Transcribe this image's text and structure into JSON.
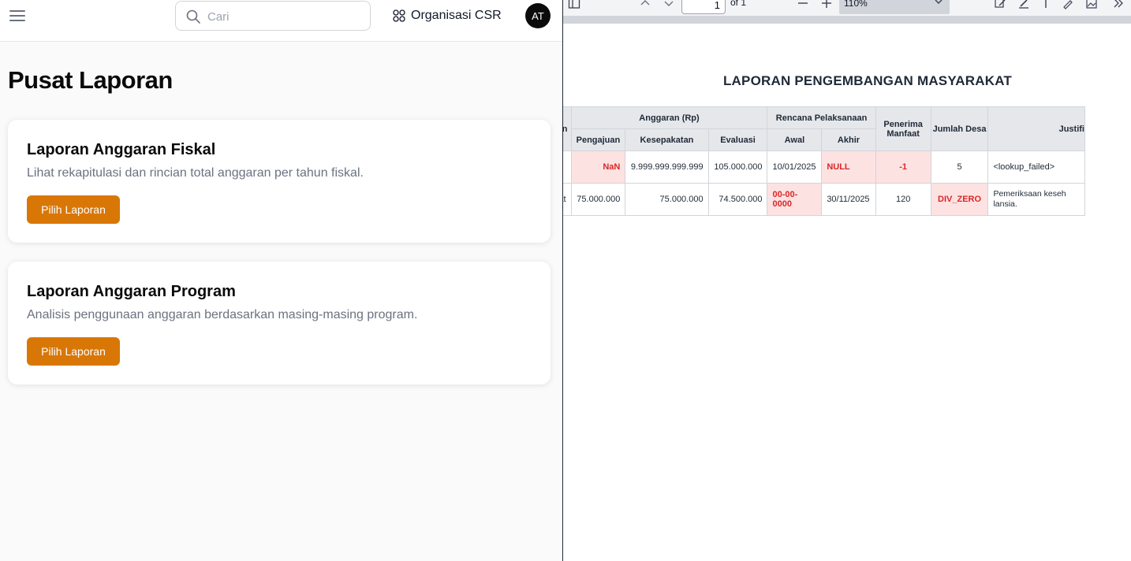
{
  "app": {
    "search": {
      "placeholder": "Cari",
      "value": ""
    },
    "org_switcher": {
      "label": "Organisasi CSR"
    },
    "avatar": {
      "initials": "AT"
    },
    "page_title": "Pusat Laporan",
    "cards": [
      {
        "title": "Laporan Anggaran Fiskal",
        "description": "Lihat rekapitulasi dan rincian total anggaran per tahun fiskal.",
        "button_label": "Pilih Laporan"
      },
      {
        "title": "Laporan Anggaran Program",
        "description": "Analisis penggunaan anggaran berdasarkan masing-masing program.",
        "button_label": "Pilih Laporan"
      }
    ],
    "colors": {
      "accent": "#d97706",
      "background": "#fafafa"
    }
  },
  "pdf_viewer": {
    "toolbar": {
      "page_number": "1",
      "page_of": "of 1",
      "zoom": "110%",
      "icons": [
        "sidebar-icon",
        "page-up-icon",
        "page-down-icon",
        "zoom-out-icon",
        "zoom-in-icon",
        "add-text-icon",
        "highlight-icon",
        "text-icon",
        "draw-icon",
        "image-icon",
        "more-tools-icon"
      ]
    },
    "report": {
      "title": "LAPORAN PENGEMBANGAN MASYARAKAT",
      "headers": {
        "col0": "n",
        "anggaran_group": "Anggaran (Rp)",
        "rencana_group": "Rencana Pelaksanaan",
        "penerima": "Penerima Manfaat",
        "jumlah_desa": "Jumlah Desa",
        "justifikasi": "Justifi",
        "pengajuan": "Pengajuan",
        "kesepakatan": "Kesepakatan",
        "evaluasi": "Evaluasi",
        "awal": "Awal",
        "akhir": "Akhir"
      },
      "rows": [
        {
          "program": "",
          "pengajuan": "NaN",
          "kesepakatan": "9.999.999.999.999",
          "evaluasi": "105.000.000",
          "awal": "10/01/2025",
          "akhir": "NULL",
          "penerima": "-1",
          "jumlah_desa": "5",
          "justifikasi": "<lookup_failed>"
        },
        {
          "program": "ia Sehat",
          "pengajuan": "75.000.000",
          "kesepakatan": "75.000.000",
          "evaluasi": "74.500.000",
          "awal": "00-00-0000",
          "akhir": "30/11/2025",
          "penerima": "120",
          "jumlah_desa": "DIV_ZERO",
          "justifikasi": "Pemeriksaan keseh lansia."
        }
      ],
      "colors": {
        "header_bg": "#e5e7eb",
        "error_bg": "#fde2e2",
        "error_text": "#dc2626"
      }
    }
  }
}
